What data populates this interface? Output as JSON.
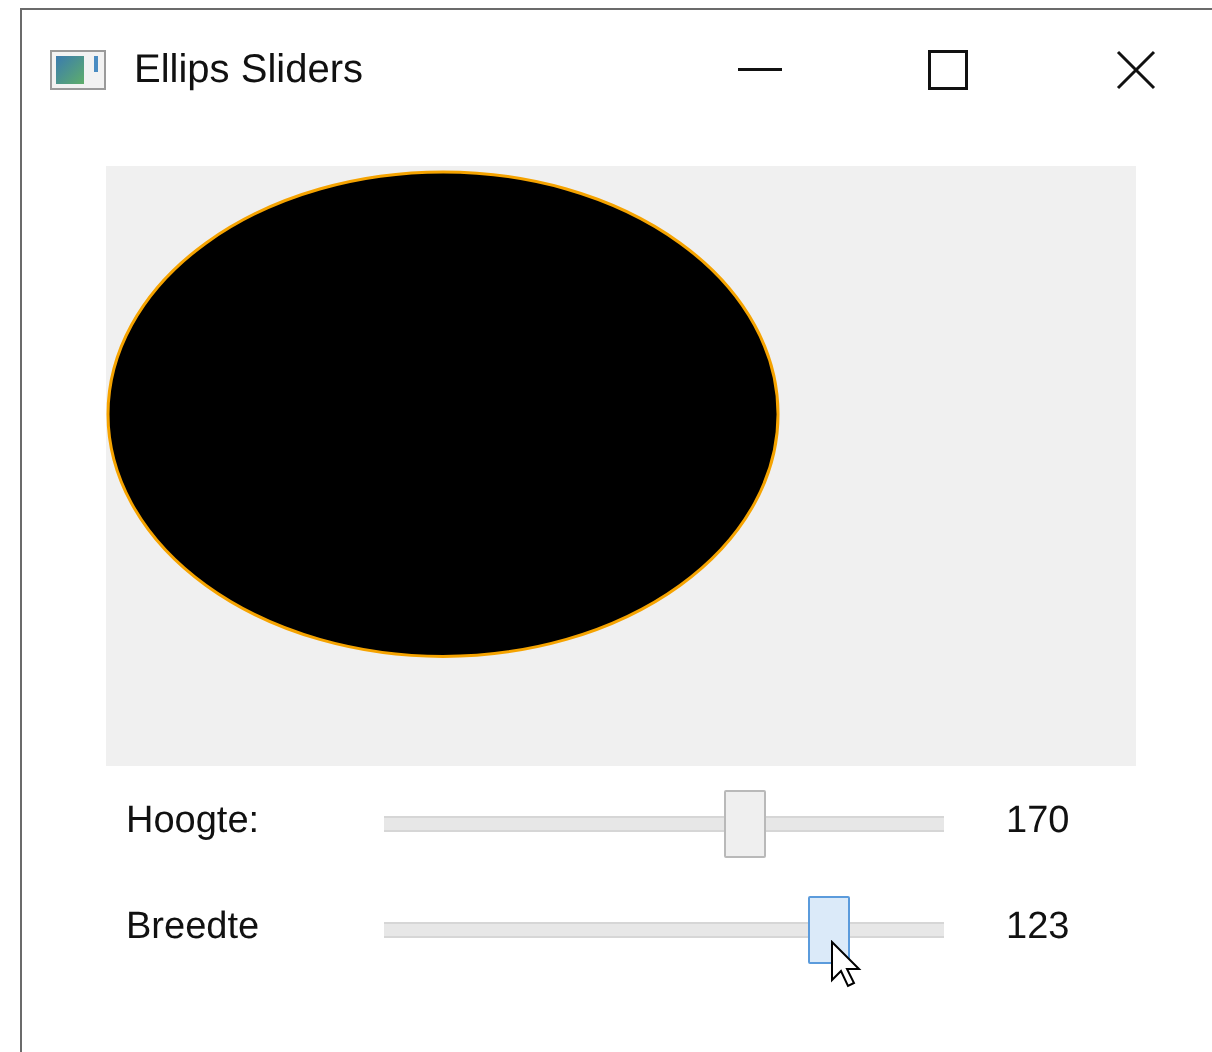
{
  "window": {
    "title": "Ellips Sliders"
  },
  "sliders": [
    {
      "label": "Hoogte:",
      "level": 0.66,
      "reading": "170",
      "hovered": false
    },
    {
      "label": "Breedte",
      "level": 0.82,
      "reading": "123",
      "hovered": true
    }
  ]
}
